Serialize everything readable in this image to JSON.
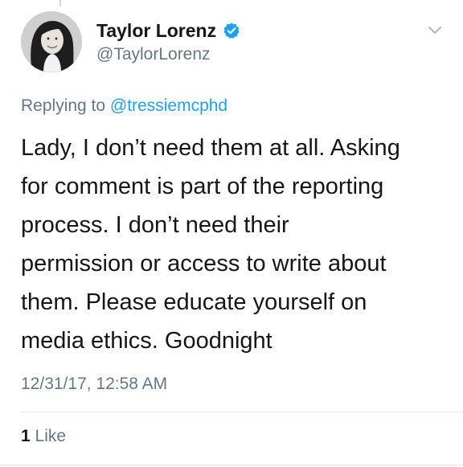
{
  "tweet": {
    "author": {
      "name": "Taylor Lorenz",
      "handle": "@TaylorLorenz",
      "verified": true
    },
    "replying_prefix": "Replying to",
    "replying_to": "@tressiemcphd",
    "text_lines": [
      "Lady, I don’t need them at all. Asking",
      "for comment is part of the reporting",
      "process. I don’t need their",
      "permission or access to write about",
      "them. Please educate yourself on",
      "media ethics. Goodnight"
    ],
    "timestamp": "12/31/17, 12:58 AM",
    "likes": {
      "count": "1",
      "label": "Like"
    }
  },
  "colors": {
    "verified_badge": "#1da1f2",
    "mention": "#1da1f2",
    "secondary_text": "#657786",
    "primary_text": "#14171a"
  },
  "icons": {
    "verified": "verified-badge-icon",
    "menu": "chevron-down-icon"
  }
}
